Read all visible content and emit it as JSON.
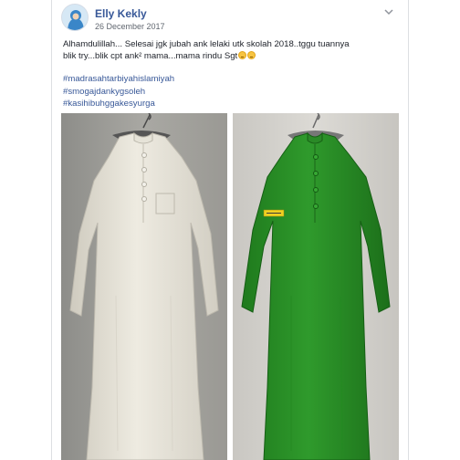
{
  "post": {
    "author": "Elly Kekly",
    "date": "26 December 2017",
    "text_line1": "Alhamdulillah... Selesai jgk jubah ank lelaki utk skolah 2018..tggu tuannya",
    "text_line2": "blik try...blik cpt ank² mama...mama rindu Sgt",
    "hashtags": [
      "#madrasahtarbiyahislamiyah",
      "#smogajdankygsoleh",
      "#kasihibuhggakesyurga"
    ],
    "photos": [
      {
        "icon": "white-robe-photo",
        "garment_color": "#e6e3d8"
      },
      {
        "icon": "green-robe-photo",
        "garment_color": "#2f8f2c",
        "label_color": "#f0d021"
      }
    ],
    "colors": {
      "link": "#385898",
      "text": "#1d2129",
      "meta": "#616770"
    }
  }
}
